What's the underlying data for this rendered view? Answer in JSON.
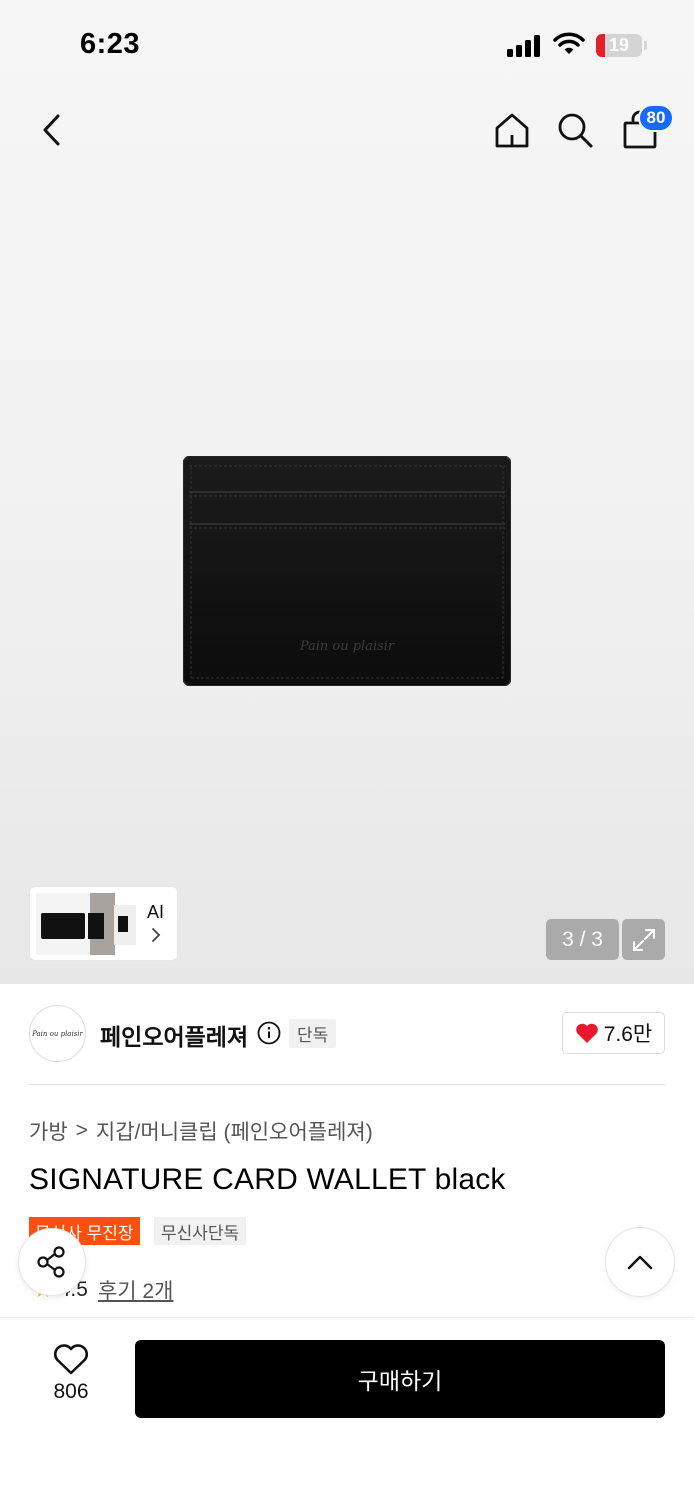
{
  "status_bar": {
    "time": "6:23",
    "battery": "19",
    "battery_level": 0.19
  },
  "nav": {
    "cart_count": "80",
    "icons": [
      "back-icon",
      "home-icon",
      "search-icon",
      "shopping-bag-icon"
    ]
  },
  "gallery": {
    "ai_label": "AI",
    "counter": "3 / 3",
    "wallet_brand_script": "Pain ou plaisir"
  },
  "brand": {
    "logo_text": "Pain ou plaisir",
    "name": "페인오어플레져",
    "tag": "단독",
    "likes": "7.6만"
  },
  "breadcrumb": {
    "category": "가방",
    "separator": ">",
    "subcategory": "지갑/머니클립 (페인오어플레져)"
  },
  "product": {
    "title": "SIGNATURE CARD WALLET black",
    "tags": [
      "무신사 무진장",
      "무신사단독"
    ],
    "rating": "4.5",
    "reviews": "후기 2개"
  },
  "bottom": {
    "wish_count": "806",
    "buy_label": "구매하기"
  },
  "colors": {
    "accent_blue": "#1769ff",
    "tag_orange": "#ff4f0f",
    "heart_red": "#e8192c",
    "buy_black": "#000000"
  }
}
